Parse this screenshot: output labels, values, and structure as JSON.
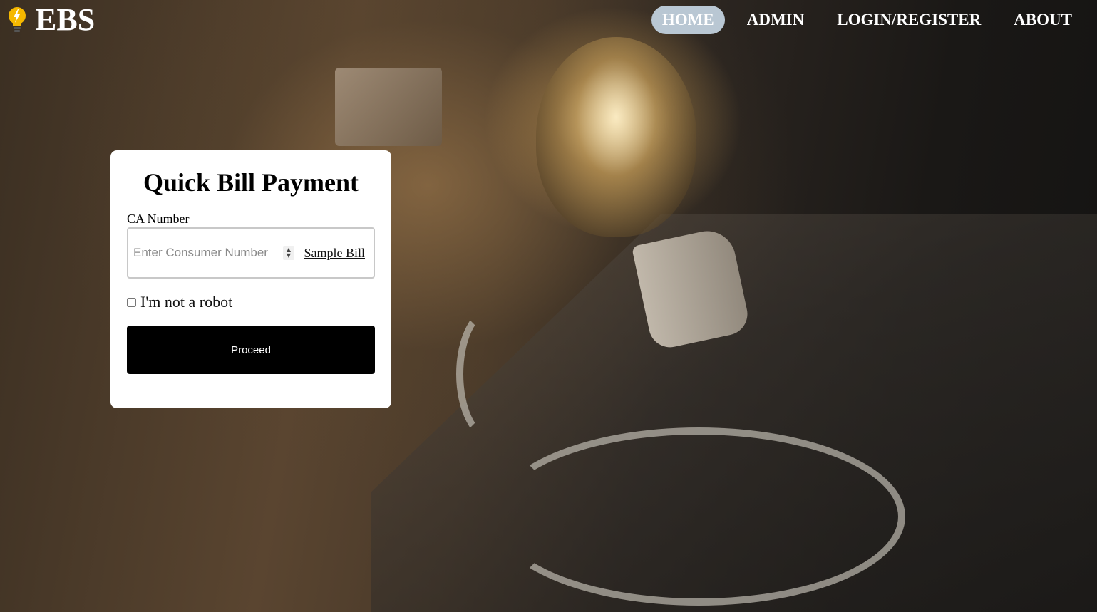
{
  "brand": {
    "name": "EBS",
    "icon": "lightbulb-bolt-icon"
  },
  "nav": {
    "items": [
      {
        "label": "HOME",
        "active": true
      },
      {
        "label": "ADMIN",
        "active": false
      },
      {
        "label": "LOGIN/REGISTER",
        "active": false
      },
      {
        "label": "ABOUT",
        "active": false
      }
    ],
    "active_color": "#b9c7d3"
  },
  "quick_pay": {
    "title": "Quick Bill Payment",
    "ca_label": "CA Number",
    "ca_placeholder": "Enter Consumer Number",
    "ca_value": "",
    "sample_bill_link": "Sample Bill",
    "robot_label": "I'm not a robot",
    "robot_checked": false,
    "proceed_label": "Proceed"
  },
  "colors": {
    "button_bg": "#000000",
    "card_bg": "#ffffff"
  }
}
